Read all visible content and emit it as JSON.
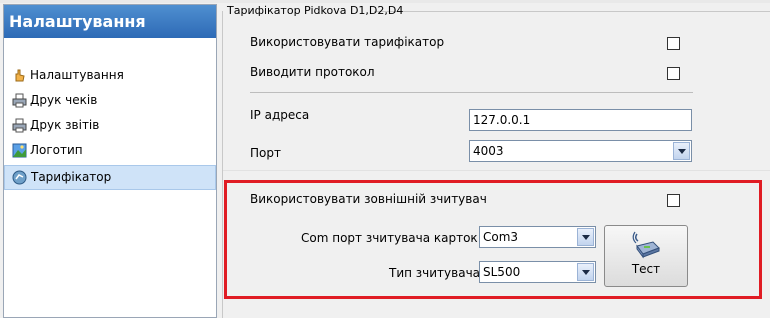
{
  "sidebar": {
    "title": "Налаштування",
    "items": [
      {
        "label": "Налаштування",
        "icon": "settings-hand-icon"
      },
      {
        "label": "Друк чеків",
        "icon": "printer-icon"
      },
      {
        "label": "Друк звітів",
        "icon": "printer-icon"
      },
      {
        "label": "Логотип",
        "icon": "image-icon"
      },
      {
        "label": "Тарифікатор",
        "icon": "tariff-icon",
        "selected": true
      }
    ]
  },
  "tariffer": {
    "group_title": "Тарифікатор Pidkova D1,D2,D4",
    "use_label": "Використовувати тарифікатор",
    "use_checked": false,
    "protocol_label": "Виводити протокол",
    "protocol_checked": false,
    "ip_label": "IP адреса",
    "ip_value": "127.0.0.1",
    "port_label": "Порт",
    "port_value": "4003"
  },
  "reader": {
    "use_label": "Використовувати зовнішній зчитувач",
    "use_checked": false,
    "com_label": "Com порт зчитувача карток",
    "com_value": "Com3",
    "type_label": "Тип зчитувача",
    "type_value": "SL500",
    "test_label": "Тест"
  },
  "colors": {
    "header_blue": "#2d6ab6",
    "selection": "#cfe3f8",
    "highlight_red": "#e01c24"
  }
}
